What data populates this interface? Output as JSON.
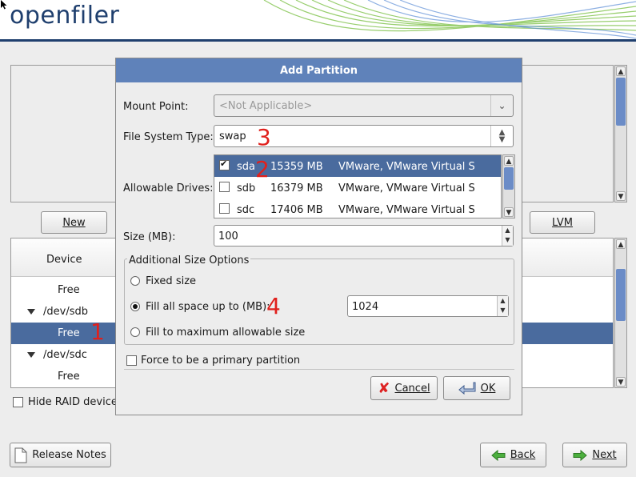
{
  "app": {
    "logo_text": "openfiler"
  },
  "main": {
    "buttons": {
      "new": "New",
      "lvm": "LVM"
    },
    "tree": {
      "header": "Device",
      "rows": [
        {
          "label": "Free",
          "type": "free",
          "selected": false
        },
        {
          "label": "/dev/sdb",
          "type": "device",
          "selected": false
        },
        {
          "label": "Free",
          "type": "free",
          "selected": true
        },
        {
          "label": "/dev/sdc",
          "type": "device",
          "selected": false
        },
        {
          "label": "Free",
          "type": "free",
          "selected": false
        }
      ]
    },
    "hide_raid_label": "Hide RAID device/"
  },
  "footer": {
    "release_notes": "Release Notes",
    "back": "Back",
    "next": "Next"
  },
  "dialog": {
    "title": "Add Partition",
    "mount_point_label": "Mount Point:",
    "mount_point_value": "<Not Applicable>",
    "fs_type_label": "File System Type:",
    "fs_type_value": "swap",
    "allowable_drives_label": "Allowable Drives:",
    "drives": [
      {
        "checked": true,
        "name": "sda",
        "size": "15359 MB",
        "model": "VMware, VMware Virtual S",
        "selected": true
      },
      {
        "checked": false,
        "name": "sdb",
        "size": "16379 MB",
        "model": "VMware, VMware Virtual S",
        "selected": false
      },
      {
        "checked": false,
        "name": "sdc",
        "size": "17406 MB",
        "model": "VMware, VMware Virtual S",
        "selected": false
      }
    ],
    "size_label": "Size (MB):",
    "size_value": "100",
    "additional_options_title": "Additional Size Options",
    "fixed_size_label": "Fixed size",
    "fill_up_to_label": "Fill all space up to (MB):",
    "fill_up_to_value": "1024",
    "fill_max_label": "Fill to maximum allowable size",
    "selected_size_option": "fill_up_to",
    "force_primary_label": "Force to be a primary partition",
    "force_primary_checked": false,
    "cancel": "Cancel",
    "ok": "OK"
  },
  "annotations": [
    "1",
    "2",
    "3",
    "4"
  ],
  "colors": {
    "title_bar": "#5f82ba",
    "selection": "#4a6b9e",
    "logo": "#1f3f6e",
    "annotation": "#e0201c"
  }
}
